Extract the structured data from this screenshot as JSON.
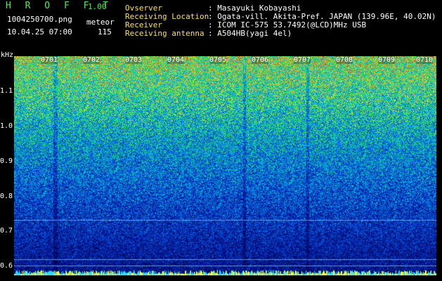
{
  "header": {
    "app_title": "H R O F F T",
    "version": "1.00",
    "filename": "1004250700.png",
    "datetime": "10.04.25 07:00",
    "count_label": "meteor",
    "count_value": "115",
    "fields": [
      {
        "label": "Ovserver",
        "value": ": Masayuki Kobayashi"
      },
      {
        "label": "Receiving Location",
        "value": ": Ogata-vill. Akita-Pref. JAPAN (139.96E, 40.02N)"
      },
      {
        "label": "Receiver",
        "value": ": ICOM IC-575 53.7492(@LCD)MHz USB"
      },
      {
        "label": "Receiving antenna",
        "value": ": A504HB(yagi 4el)"
      }
    ]
  },
  "axes": {
    "y_unit": "kHz",
    "y_ticks": [
      "1.1",
      "1.0",
      "0.9",
      "0.8",
      "0.7",
      "0.6"
    ],
    "x_ticks": [
      "0701",
      "0702",
      "0703",
      "0704",
      "0705",
      "0706",
      "0707",
      "0708",
      "0709",
      "0710"
    ]
  },
  "colors": {
    "background": "#000000",
    "label_green": "#4af04a",
    "label_yellow": "#ffe24a",
    "text_white": "#ffffff"
  }
}
